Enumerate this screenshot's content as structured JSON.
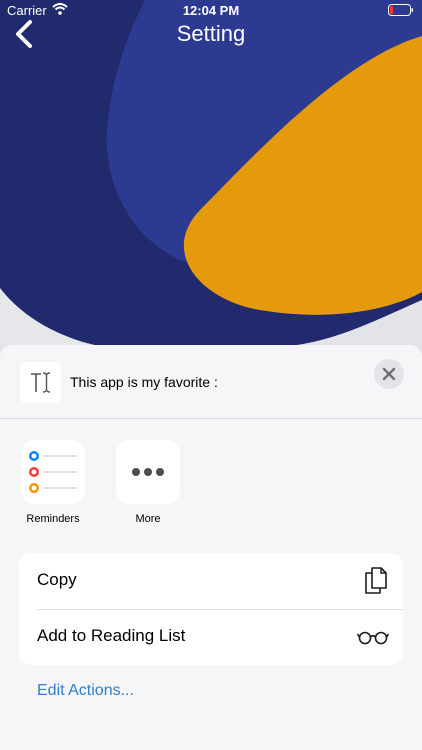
{
  "status_bar": {
    "carrier": "Carrier",
    "time": "12:04 PM"
  },
  "nav": {
    "title": "Setting"
  },
  "colors": {
    "navy": "#222a6e",
    "royal_blue": "#2c3a91",
    "orange": "#e59a0b",
    "link_blue": "#2f7fd1"
  },
  "share_sheet": {
    "header_text": "This app is my favorite :",
    "app_thumb_icon": "text-cursor-icon",
    "close_icon": "close-icon",
    "apps": [
      {
        "label": "Reminders",
        "icon": "reminders-icon"
      },
      {
        "label": "More",
        "icon": "more-icon"
      }
    ],
    "actions": [
      {
        "label": "Copy",
        "icon": "copy-icon"
      },
      {
        "label": "Add to Reading List",
        "icon": "glasses-icon"
      }
    ],
    "edit_actions_label": "Edit Actions..."
  }
}
